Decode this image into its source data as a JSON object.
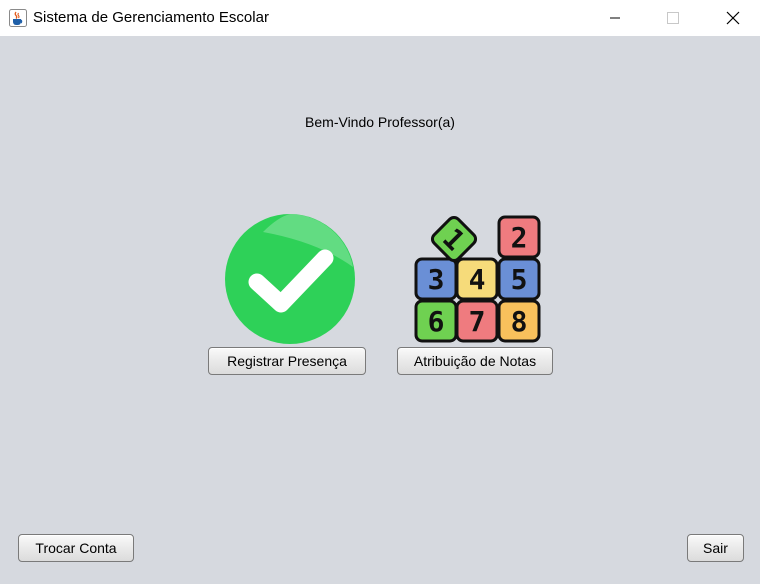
{
  "window": {
    "title": "Sistema de Gerenciamento Escolar",
    "icon": "java-coffee-icon"
  },
  "main": {
    "welcome_text": "Bem-Vindo Professor(a)",
    "actions": [
      {
        "label": "Registrar Presença",
        "icon": "green-check-icon"
      },
      {
        "label": "Atribuição de Notas",
        "icon": "number-tiles-icon"
      }
    ]
  },
  "footer": {
    "switch_account_label": "Trocar Conta",
    "exit_label": "Sair"
  },
  "number_tiles": [
    "1",
    "2",
    "3",
    "4",
    "5",
    "6",
    "7",
    "8"
  ],
  "colors": {
    "background": "#d6d9df",
    "check_green": "#2ecc55",
    "tile_red": "#ef7b7f",
    "tile_blue": "#6a8fd6",
    "tile_yellow": "#f6db7a",
    "tile_green": "#6fd151",
    "tile_orange": "#f8c15c"
  }
}
